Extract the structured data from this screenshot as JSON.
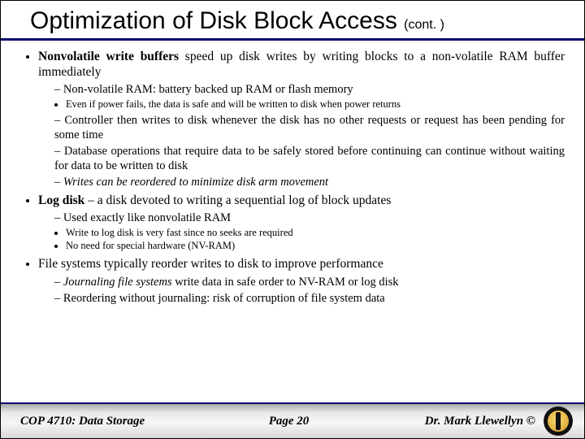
{
  "title": {
    "main": "Optimization of Disk Block Access",
    "cont": "(cont. )"
  },
  "bullets": {
    "b1_pre": "Nonvolatile write buffers",
    "b1_post": " speed up disk writes by writing blocks to a non-volatile RAM buffer immediately",
    "b1s1": "Non-volatile RAM:  battery backed up RAM or flash memory",
    "b1s1a": "Even if power fails, the data is safe and will be written to disk when power returns",
    "b1s2": "Controller then writes to disk whenever the disk has no other requests or request has been pending for some time",
    "b1s3": "Database operations that require data to be safely stored before continuing can continue without waiting for data to be written to disk",
    "b1s4": "Writes can be reordered to minimize disk arm movement",
    "b2_pre": "Log disk",
    "b2_post": " – a disk devoted to writing a sequential log of block updates",
    "b2s1": " Used exactly like nonvolatile RAM",
    "b2s1a": "Write to log disk is very fast since no seeks are required",
    "b2s1b": "No need for special hardware (NV-RAM)",
    "b3": "File systems typically reorder writes to disk to improve performance",
    "b3s1_pre": "Journaling file systems",
    "b3s1_post": " write data in safe order to NV-RAM or log disk",
    "b3s2": "Reordering without journaling: risk of corruption of file system data"
  },
  "footer": {
    "course": "COP 4710: Data Storage",
    "page": "Page 20",
    "author": "Dr. Mark Llewellyn ©"
  }
}
